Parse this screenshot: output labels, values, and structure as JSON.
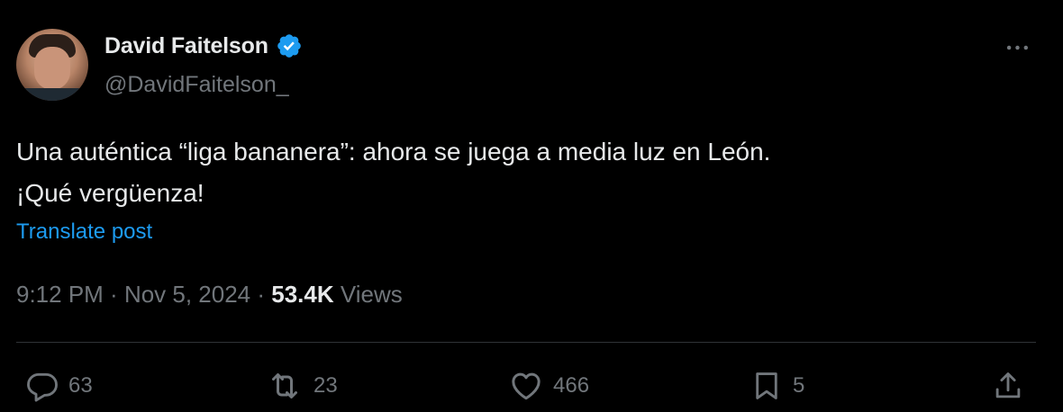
{
  "author": {
    "display_name": "David Faitelson",
    "handle": "@DavidFaitelson_",
    "verified": true
  },
  "post": {
    "text": "Una auténtica “liga bananera”: ahora se juega a media luz en León.\n¡Qué vergüenza!",
    "translate_label": "Translate post"
  },
  "meta": {
    "time": "9:12 PM",
    "separator": " · ",
    "date": "Nov 5, 2024",
    "views_count": "53.4K",
    "views_label": " Views"
  },
  "actions": {
    "replies": "63",
    "reposts": "23",
    "likes": "466",
    "bookmarks": "5"
  },
  "icons": {
    "verified": "verified-badge-icon",
    "more": "more-dots-icon",
    "reply": "reply-bubble-icon",
    "repost": "repost-arrows-icon",
    "like": "heart-icon",
    "bookmark": "bookmark-icon",
    "share": "share-upload-icon"
  },
  "colors": {
    "background": "#000000",
    "text": "#e7e9ea",
    "secondary": "#71767b",
    "link": "#1d9bf0",
    "divider": "#2f3336"
  }
}
